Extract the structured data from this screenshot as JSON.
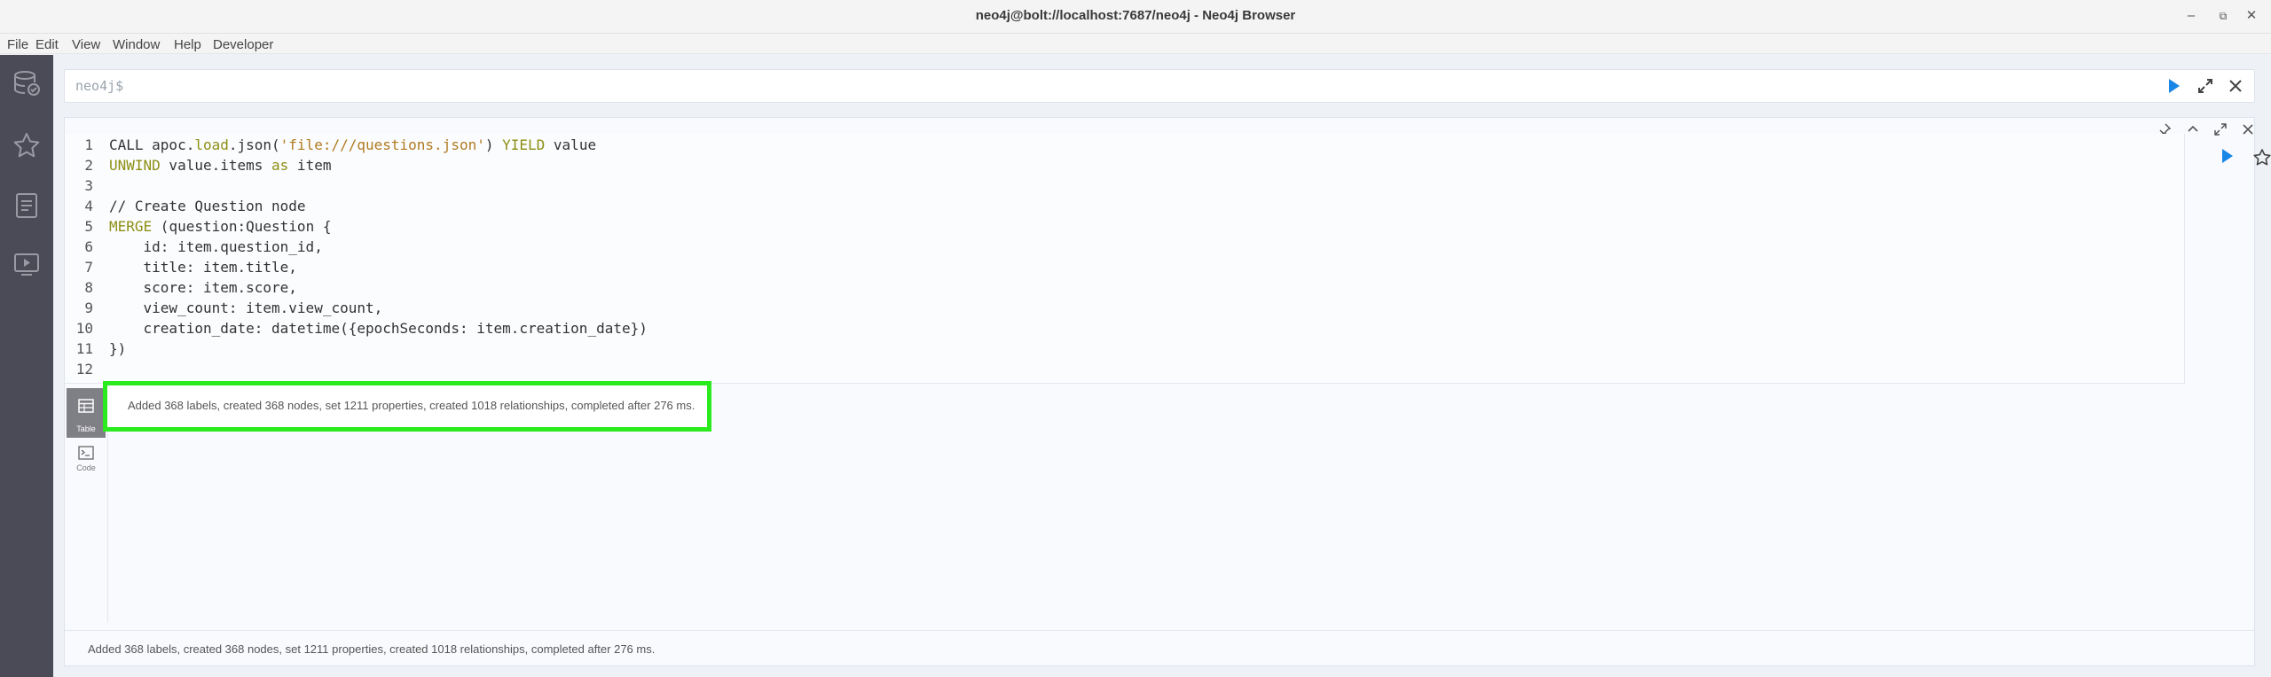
{
  "window": {
    "title": "neo4j@bolt://localhost:7687/neo4j - Neo4j Browser"
  },
  "menu": [
    "File",
    "Edit",
    "View",
    "Window",
    "Help",
    "Developer"
  ],
  "editor": {
    "prompt": "neo4j$"
  },
  "query": {
    "lines": [
      {
        "n": "1",
        "parts": [
          [
            "",
            "CALL apoc."
          ],
          [
            "kw",
            "load"
          ],
          [
            "",
            ".json("
          ],
          [
            "str",
            "'file:///questions.json'"
          ],
          [
            "",
            ") "
          ],
          [
            "kw",
            "YIELD"
          ],
          [
            "",
            " value"
          ]
        ]
      },
      {
        "n": "2",
        "parts": [
          [
            "kw",
            "UNWIND"
          ],
          [
            "",
            " value.items "
          ],
          [
            "kw",
            "as"
          ],
          [
            "",
            " item"
          ]
        ]
      },
      {
        "n": "3",
        "parts": []
      },
      {
        "n": "4",
        "parts": [
          [
            "cmt",
            "// Create Question node"
          ]
        ]
      },
      {
        "n": "5",
        "parts": [
          [
            "kw",
            "MERGE"
          ],
          [
            "",
            " (question:Question {"
          ]
        ]
      },
      {
        "n": "6",
        "parts": [
          [
            "",
            "    id: item.question_id,"
          ]
        ]
      },
      {
        "n": "7",
        "parts": [
          [
            "",
            "    title: item.title,"
          ]
        ]
      },
      {
        "n": "8",
        "parts": [
          [
            "",
            "    score: item.score,"
          ]
        ]
      },
      {
        "n": "9",
        "parts": [
          [
            "",
            "    view_count: item.view_count,"
          ]
        ]
      },
      {
        "n": "10",
        "parts": [
          [
            "",
            "    creation_date: datetime({epochSeconds: item.creation_date})"
          ]
        ]
      },
      {
        "n": "11",
        "parts": [
          [
            "",
            "})"
          ]
        ]
      },
      {
        "n": "12",
        "parts": []
      }
    ]
  },
  "views": {
    "table_label": "Table",
    "code_label": "Code"
  },
  "result": {
    "message": "Added 368 labels, created 368 nodes, set 1211 properties, created 1018 relationships, completed after 276 ms.",
    "status": "Added 368 labels, created 368 nodes, set 1211 properties, created 1018 relationships, completed after 276 ms."
  },
  "colors": {
    "sidebar": "#4b4b57",
    "run_button": "#1a87e6",
    "highlight": "#2aeb1e"
  }
}
